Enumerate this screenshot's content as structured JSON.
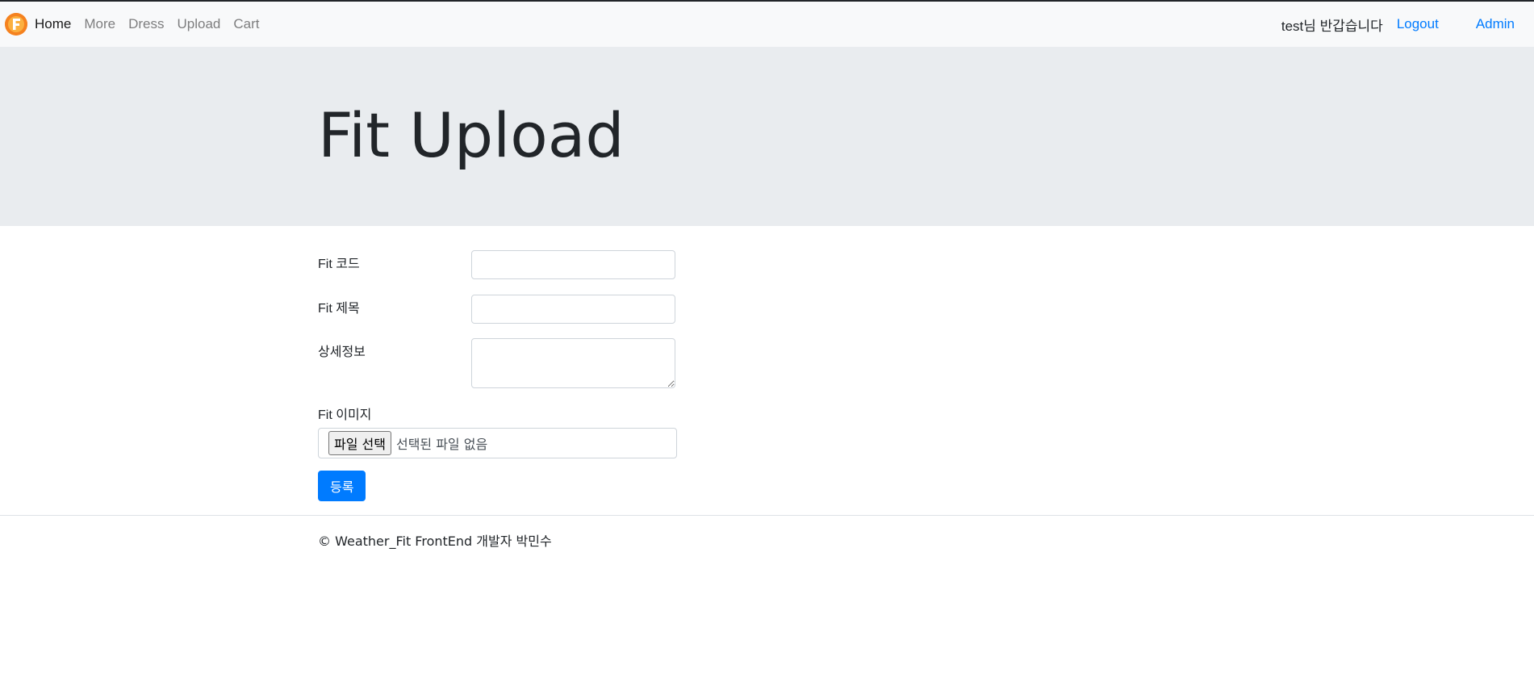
{
  "nav": {
    "logo_icon": "f-letter-logo",
    "brand_color": "#f5821f",
    "links": [
      {
        "label": "Home"
      },
      {
        "label": "More"
      },
      {
        "label": "Dress"
      },
      {
        "label": "Upload"
      },
      {
        "label": "Cart"
      }
    ],
    "greeting": "test님 반갑습니다",
    "logout_label": "Logout",
    "admin_label": "Admin",
    "link_color": "#007bff"
  },
  "jumbotron": {
    "title": "Fit Upload",
    "background": "#e9ecef"
  },
  "form": {
    "code_label": "Fit 코드",
    "code_value": "",
    "title_label": "Fit 제목",
    "title_value": "",
    "detail_label": "상세정보",
    "detail_value": "",
    "image_label": "Fit 이미지",
    "file_button_label": "파일 선택",
    "file_status": "선택된 파일 없음",
    "submit_label": "등록",
    "submit_color": "#007bff"
  },
  "footer": {
    "text": "© Weather_Fit FrontEnd 개발자 박민수"
  }
}
